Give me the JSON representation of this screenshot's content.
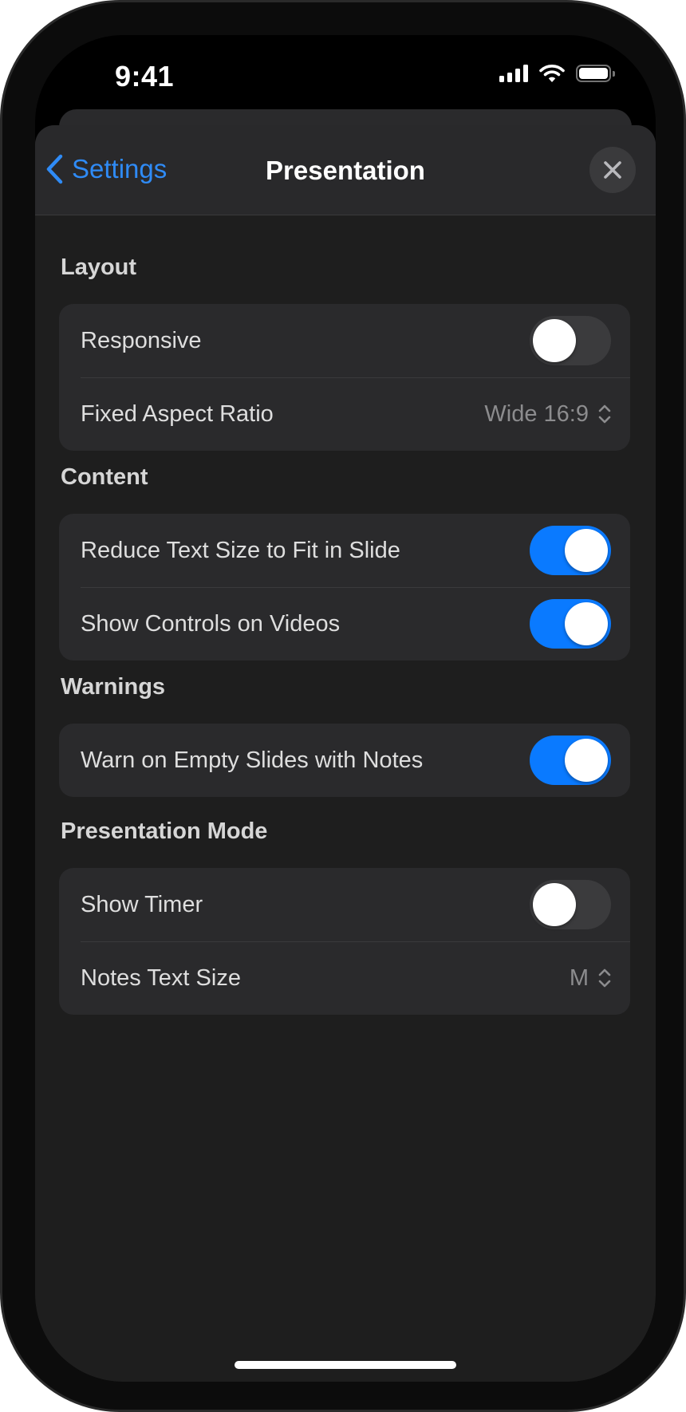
{
  "status_bar": {
    "time": "9:41"
  },
  "nav": {
    "back_label": "Settings",
    "title": "Presentation"
  },
  "sections": {
    "layout": {
      "title": "Layout",
      "responsive": {
        "label": "Responsive",
        "on": false
      },
      "aspect_ratio": {
        "label": "Fixed Aspect Ratio",
        "value": "Wide 16:9"
      }
    },
    "content": {
      "title": "Content",
      "reduce_text": {
        "label": "Reduce Text Size to Fit in Slide",
        "on": true
      },
      "show_controls": {
        "label": "Show Controls on Videos",
        "on": true
      }
    },
    "warnings": {
      "title": "Warnings",
      "warn_empty": {
        "label": "Warn on Empty Slides with Notes",
        "on": true
      }
    },
    "presentation_mode": {
      "title": "Presentation Mode",
      "show_timer": {
        "label": "Show Timer",
        "on": false
      },
      "notes_text_size": {
        "label": "Notes Text Size",
        "value": "M"
      }
    }
  },
  "colors": {
    "accent": "#0a7aff",
    "link": "#2f8bf6",
    "sheet_background": "#1e1e1e",
    "group_background": "#2a2a2c",
    "toggle_off": "#3b3b3d"
  }
}
